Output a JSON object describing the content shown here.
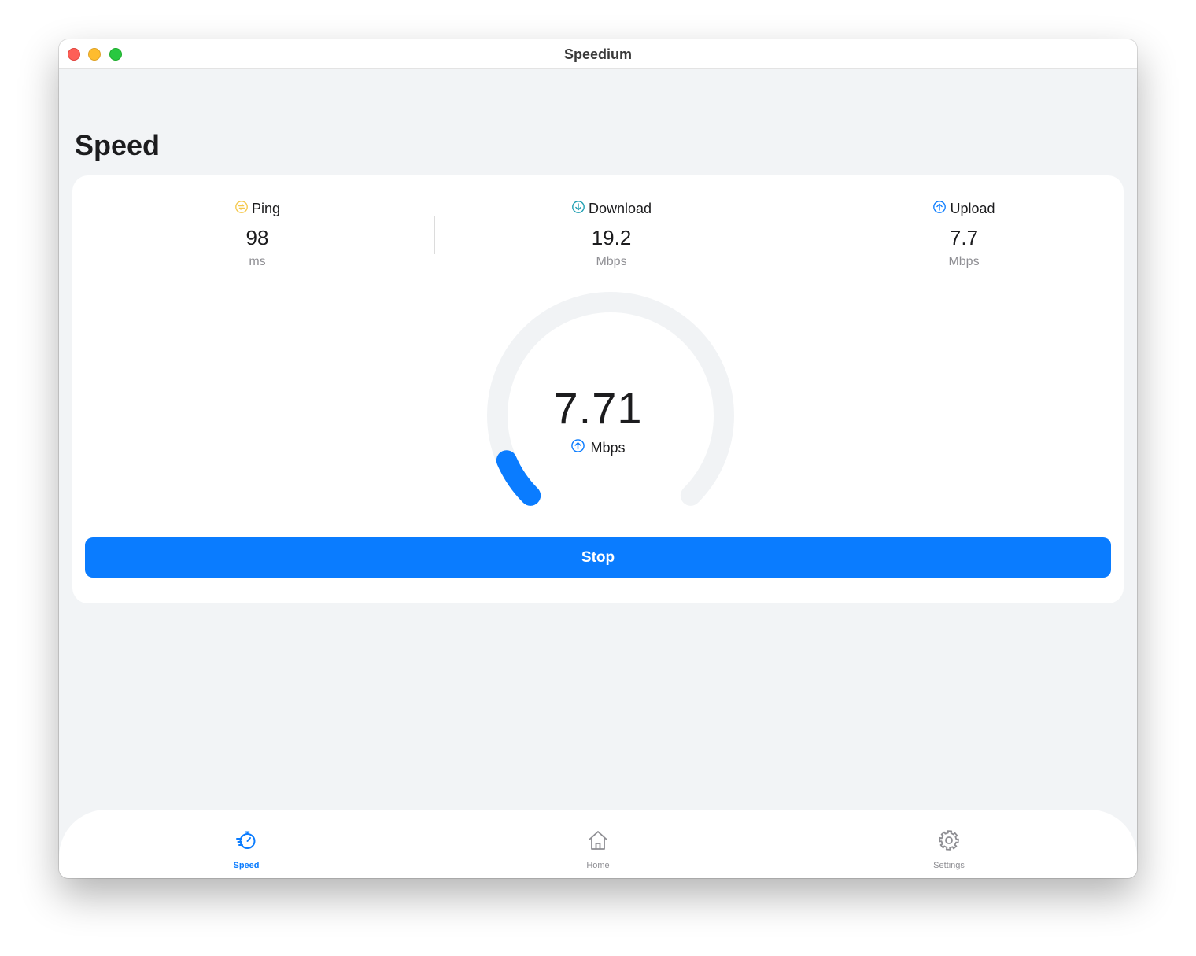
{
  "window": {
    "title": "Speedium"
  },
  "page": {
    "title": "Speed"
  },
  "stats": {
    "ping": {
      "label": "Ping",
      "value": "98",
      "unit": "ms",
      "icon": "ping-icon"
    },
    "download": {
      "label": "Download",
      "value": "19.2",
      "unit": "Mbps",
      "icon": "download-arrow-icon"
    },
    "upload": {
      "label": "Upload",
      "value": "7.7",
      "unit": "Mbps",
      "icon": "upload-arrow-icon"
    }
  },
  "gauge": {
    "value": "7.71",
    "unit": "Mbps",
    "mode_icon": "upload-arrow-icon",
    "progress_fraction": 0.08
  },
  "actions": {
    "stop_label": "Stop"
  },
  "tabbar": {
    "tabs": [
      {
        "label": "Speed",
        "icon": "speedometer-icon",
        "active": true
      },
      {
        "label": "Home",
        "icon": "home-icon",
        "active": false
      },
      {
        "label": "Settings",
        "icon": "gear-icon",
        "active": false
      }
    ]
  },
  "colors": {
    "accent": "#0a7cff",
    "ping_icon": "#f5c84a",
    "download_icon": "#1a9db0",
    "upload_icon": "#0a7cff",
    "gauge_track": "#f1f3f5"
  }
}
